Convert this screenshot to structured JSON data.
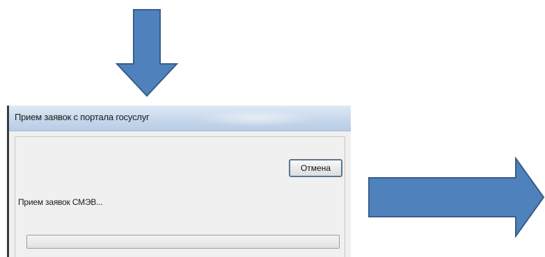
{
  "dialog": {
    "title": "Прием заявок с портала госуслуг",
    "cancel_label": "Отмена",
    "status_text": "Прием заявок СМЭВ...",
    "progress": 0
  },
  "arrows": {
    "color": "#4f81bd",
    "border_color": "#385d8a",
    "top_icon": "down-arrow-icon",
    "right_icon": "right-arrow-icon"
  }
}
